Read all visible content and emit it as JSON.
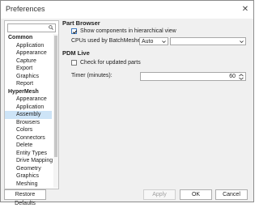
{
  "window": {
    "title": "Preferences",
    "close_glyph": "✕"
  },
  "search": {
    "placeholder": "",
    "icon": "search-icon"
  },
  "tree": {
    "groups": [
      {
        "label": "Common",
        "children": [
          "Application",
          "Appearance",
          "Capture",
          "Export",
          "Graphics",
          "Report"
        ]
      },
      {
        "label": "HyperMesh",
        "children": [
          "Appearance",
          "Application",
          "Assembly",
          "Browsers",
          "Colors",
          "Connectors",
          "Delete",
          "Entity Types",
          "Drive Mapping",
          "Geometry",
          "Graphics",
          "Meshing"
        ]
      }
    ],
    "selected": "Assembly"
  },
  "part_browser": {
    "title": "Part Browser",
    "show_hierarchical_label": "Show components in hierarchical view",
    "show_hierarchical_checked": true,
    "cpus_label": "CPUs used by BatchMesher:",
    "cpus_value": "Auto",
    "cpus_secondary_value": ""
  },
  "pdm_live": {
    "title": "PDM Live",
    "check_updates_label": "Check for updated parts",
    "check_updates_checked": false,
    "timer_label": "Timer (minutes):",
    "timer_value": "60"
  },
  "footer": {
    "restore_label": "Restore Defaults",
    "apply_label": "Apply",
    "ok_label": "OK",
    "cancel_label": "Cancel"
  },
  "colors": {
    "accent": "#3b78c0",
    "selection": "#cde4f7"
  }
}
